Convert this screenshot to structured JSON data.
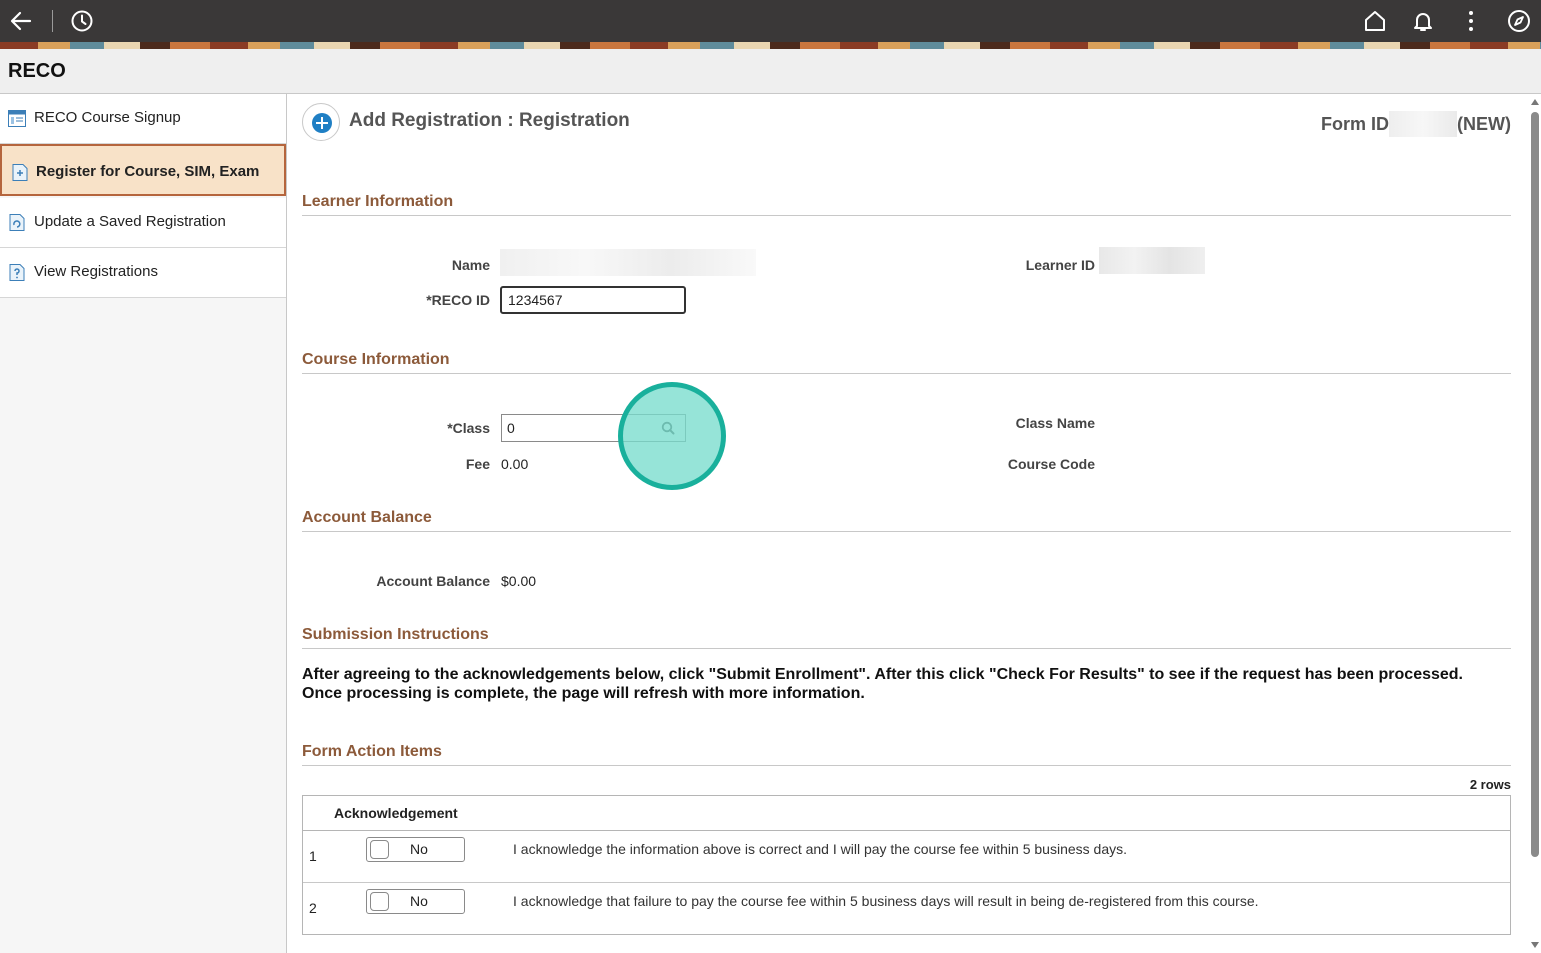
{
  "app": {
    "title": "RECO"
  },
  "topbar": {
    "icons": [
      "back-arrow-icon",
      "history-icon",
      "home-icon",
      "bell-icon",
      "more-vertical-icon",
      "compass-icon"
    ]
  },
  "sidebar": {
    "items": [
      {
        "label": "RECO Course Signup",
        "active": false
      },
      {
        "label": "Register for Course, SIM, Exam",
        "active": true
      },
      {
        "label": "Update a Saved Registration",
        "active": false
      },
      {
        "label": "View Registrations",
        "active": false
      }
    ]
  },
  "page": {
    "title": "Add Registration :  Registration",
    "form_id_label": "Form ID",
    "form_id_status": "(NEW)"
  },
  "learner": {
    "section_title": "Learner Information",
    "name_label": "Name",
    "learner_id_label": "Learner ID",
    "reco_id_label": "*RECO ID",
    "reco_id_value": "1234567"
  },
  "course": {
    "section_title": "Course Information",
    "class_label": "*Class",
    "class_value": "0",
    "fee_label": "Fee",
    "fee_value": "0.00",
    "class_name_label": "Class Name",
    "course_code_label": "Course Code"
  },
  "account": {
    "section_title": "Account Balance",
    "balance_label": "Account Balance",
    "balance_value": "$0.00"
  },
  "submission": {
    "section_title": "Submission Instructions",
    "line1": "After agreeing to the acknowledgements below, click \"Submit Enrollment\". After this click \"Check For Results\" to see if the request has been processed.",
    "line2": "Once processing is complete, the page will refresh with more information."
  },
  "form_actions": {
    "section_title": "Form Action Items",
    "rows_count": "2 rows",
    "column_header": "Acknowledgement",
    "rows": [
      {
        "num": "1",
        "toggle": "No",
        "text": "I acknowledge the information above is correct and I will pay the course fee within 5 business days."
      },
      {
        "num": "2",
        "toggle": "No",
        "text": "I acknowledge that failure to pay the course fee within 5 business days will result in being de-registered from this course."
      }
    ]
  },
  "colors": {
    "topbar": "#3a3838",
    "section_title": "#8c5a3a",
    "active_nav_bg": "#f8e2c8",
    "active_nav_border": "#b5653d",
    "highlight": "#19b09c"
  }
}
